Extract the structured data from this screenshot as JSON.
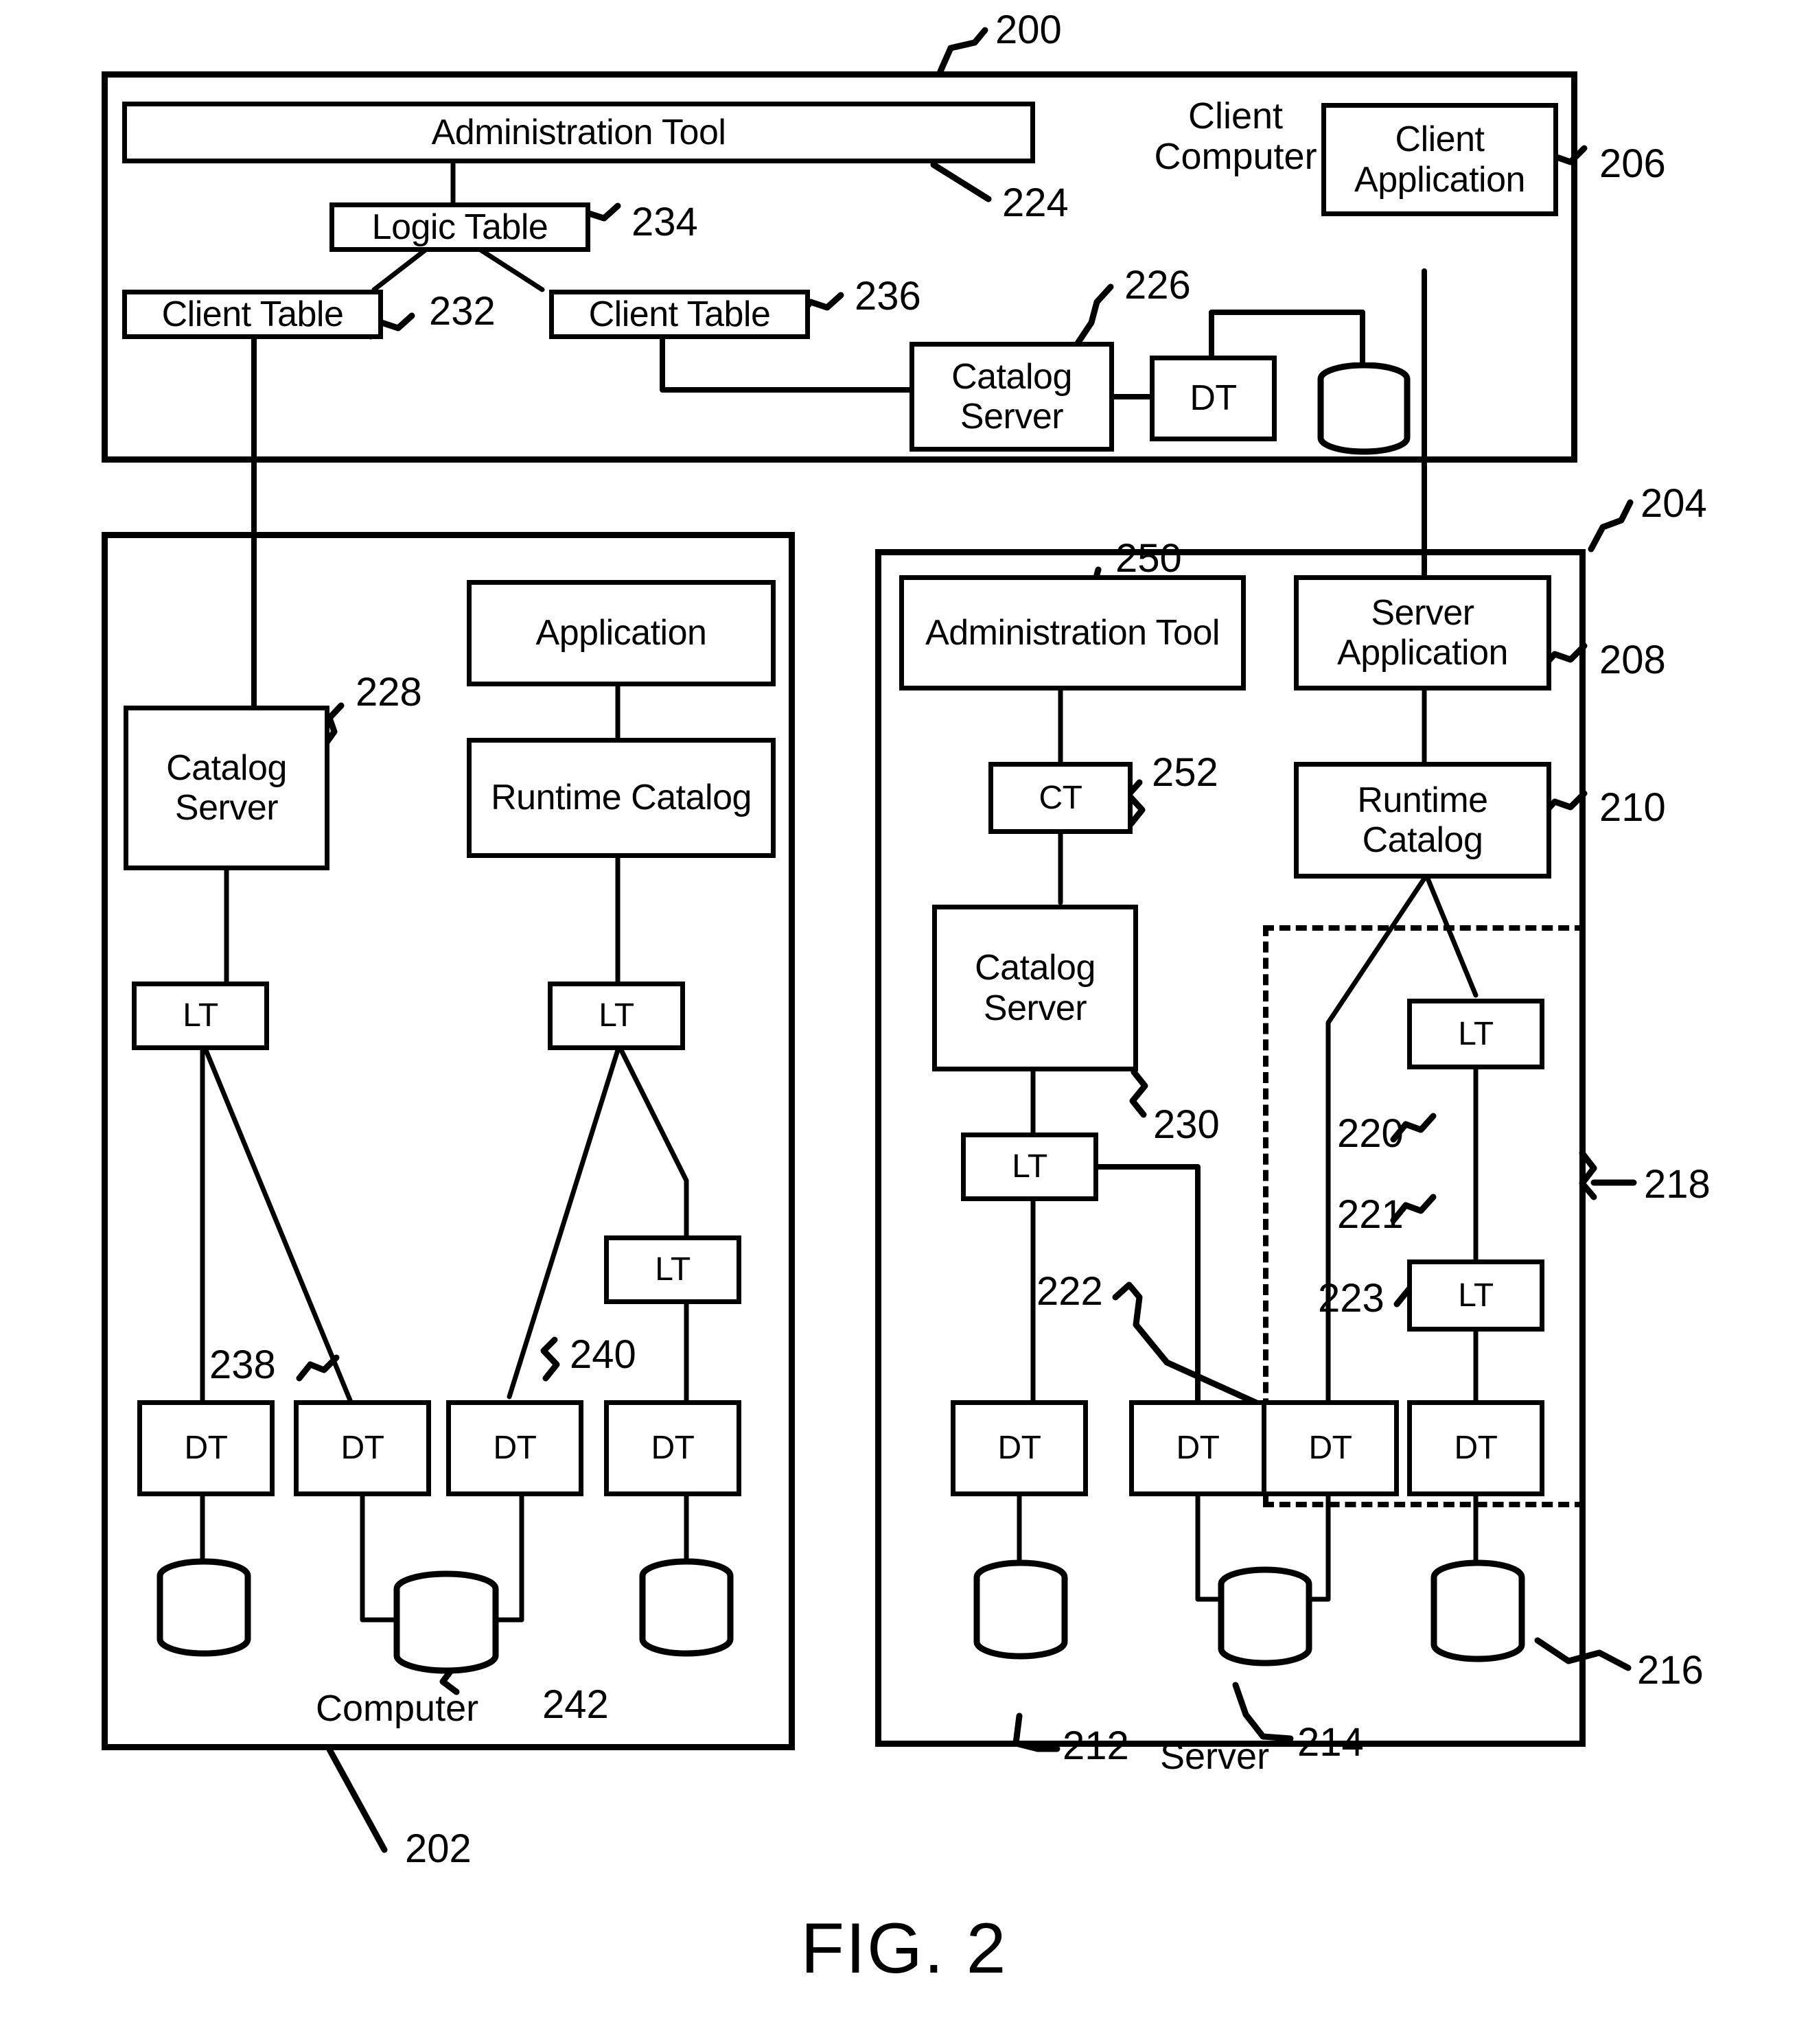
{
  "figure": {
    "caption": "FIG. 2"
  },
  "client_computer": {
    "region_ref": "200",
    "title": "Client\nComputer",
    "admin_tool": {
      "label": "Administration Tool",
      "ref": "224"
    },
    "logic_table": {
      "label": "Logic Table",
      "ref": "234"
    },
    "client_table_left": {
      "label": "Client Table",
      "ref": "232"
    },
    "client_table_right": {
      "label": "Client Table",
      "ref": "236"
    },
    "catalog_server": {
      "label": "Catalog\nServer",
      "ref": "226"
    },
    "dt": {
      "label": "DT"
    },
    "client_application": {
      "label": "Client\nApplication",
      "ref": "206"
    }
  },
  "computer_panel": {
    "region_ref": "202",
    "title": "Computer",
    "title_ref": "242",
    "catalog_server": {
      "label": "Catalog\nServer",
      "ref": "228"
    },
    "application": {
      "label": "Application"
    },
    "runtime_catalog": {
      "label": "Runtime\nCatalog"
    },
    "lt_left": {
      "label": "LT"
    },
    "lt_right": {
      "label": "LT"
    },
    "lt_lower": {
      "label": "LT"
    },
    "dt_items": [
      {
        "label": "DT"
      },
      {
        "label": "DT",
        "ref": "238"
      },
      {
        "label": "DT",
        "ref": "240"
      },
      {
        "label": "DT"
      }
    ]
  },
  "server_panel": {
    "region_ref": "204",
    "title": "Server",
    "admin_tool": {
      "label": "Administration\nTool",
      "ref": "250"
    },
    "ct": {
      "label": "CT",
      "ref": "252"
    },
    "catalog_server": {
      "label": "Catalog\nServer",
      "ref": "230"
    },
    "lt_admin": {
      "label": "LT"
    },
    "server_application": {
      "label": "Server\nApplication",
      "ref": "208"
    },
    "runtime_catalog": {
      "label": "Runtime\nCatalog",
      "ref": "210"
    },
    "dashed_group_ref": "218",
    "lt_upper": {
      "label": "LT",
      "ref": "220"
    },
    "lt_lower": {
      "label": "LT",
      "ref": "221"
    },
    "dt_items": [
      {
        "label": "DT",
        "ref": ""
      },
      {
        "label": "DT",
        "ref": "222"
      },
      {
        "label": "DT",
        "ref": ""
      },
      {
        "label": "DT",
        "ref": "223"
      }
    ],
    "db_refs": [
      "212",
      "214",
      "216"
    ]
  }
}
